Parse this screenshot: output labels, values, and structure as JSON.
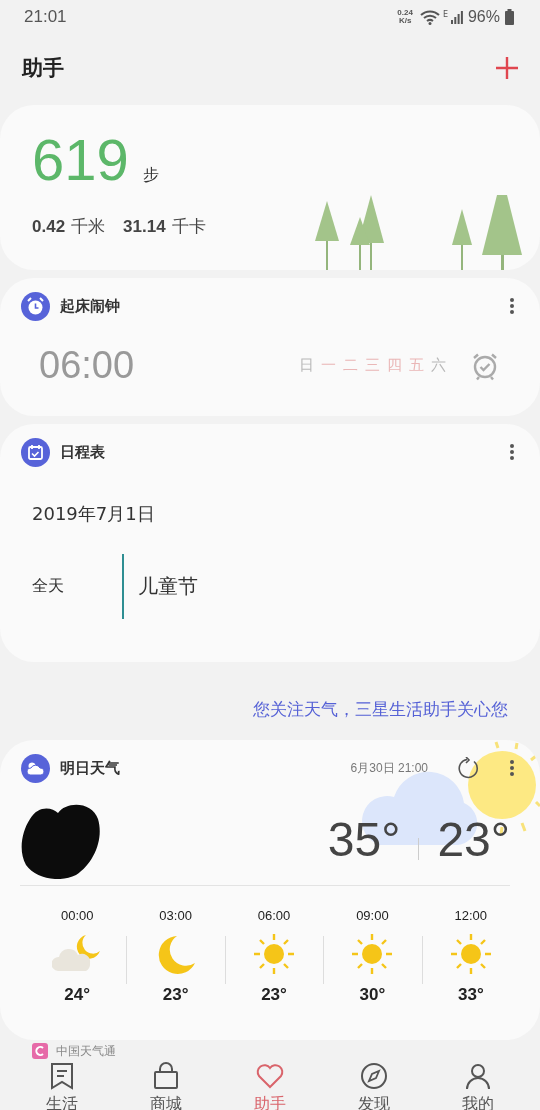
{
  "status_bar": {
    "time": "21:01",
    "speed_value": "0.24",
    "speed_unit": "K/s",
    "network": "E",
    "battery": "96%"
  },
  "header": {
    "title": "助手"
  },
  "steps_card": {
    "count": "619",
    "unit": "步",
    "distance_value": "0.42",
    "distance_unit": "千米",
    "calories_value": "31.14",
    "calories_unit": "千卡"
  },
  "alarm_card": {
    "title": "起床闹钟",
    "time": "06:00",
    "days": [
      {
        "label": "日",
        "selected": false
      },
      {
        "label": "一",
        "selected": true
      },
      {
        "label": "二",
        "selected": true
      },
      {
        "label": "三",
        "selected": true
      },
      {
        "label": "四",
        "selected": true
      },
      {
        "label": "五",
        "selected": true
      },
      {
        "label": "六",
        "selected": false
      }
    ]
  },
  "schedule_card": {
    "title": "日程表",
    "date": "2019年7月1日",
    "events": [
      {
        "time": "全天",
        "title": "儿童节"
      }
    ]
  },
  "notice": "您关注天气，三星生活助手关心您",
  "weather_card": {
    "title": "明日天气",
    "updated": "6月30日 21:00",
    "high": "35°",
    "low": "23°",
    "hours": [
      {
        "time": "00:00",
        "kind": "cloudy-night",
        "temp": "24°"
      },
      {
        "time": "03:00",
        "kind": "moon",
        "temp": "23°"
      },
      {
        "time": "06:00",
        "kind": "sun",
        "temp": "23°"
      },
      {
        "time": "09:00",
        "kind": "sun",
        "temp": "30°"
      },
      {
        "time": "12:00",
        "kind": "sun",
        "temp": "33°"
      }
    ],
    "source": "中国天气通"
  },
  "bottom_nav": [
    {
      "label": "生活",
      "kind": "life",
      "selected": false
    },
    {
      "label": "商城",
      "kind": "store",
      "selected": false
    },
    {
      "label": "助手",
      "kind": "assistant",
      "selected": true
    },
    {
      "label": "发现",
      "kind": "discover",
      "selected": false
    },
    {
      "label": "我的",
      "kind": "profile",
      "selected": false
    }
  ]
}
